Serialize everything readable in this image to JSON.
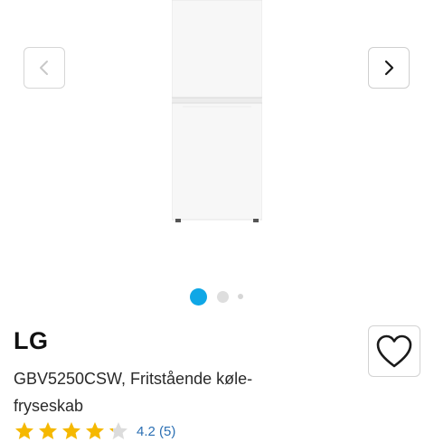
{
  "gallery": {
    "prev_icon": "chevron-left-icon",
    "next_icon": "chevron-right-icon",
    "image_alt": "LG GBV5250CSW refrigerator",
    "dots": 3,
    "active_dot": 1,
    "colors": {
      "active_dot": "#0fa7e6",
      "inactive_dot": "#dedede"
    }
  },
  "product": {
    "brand": "LG",
    "title_line1": "GBV5250CSW, Fritstående køle-",
    "title_line2": "fryseskab",
    "favorite_icon": "heart-outline-icon",
    "rating": {
      "value": 4.2,
      "max": 5,
      "label": "4.2 (5)",
      "color": "#f5b800"
    }
  }
}
